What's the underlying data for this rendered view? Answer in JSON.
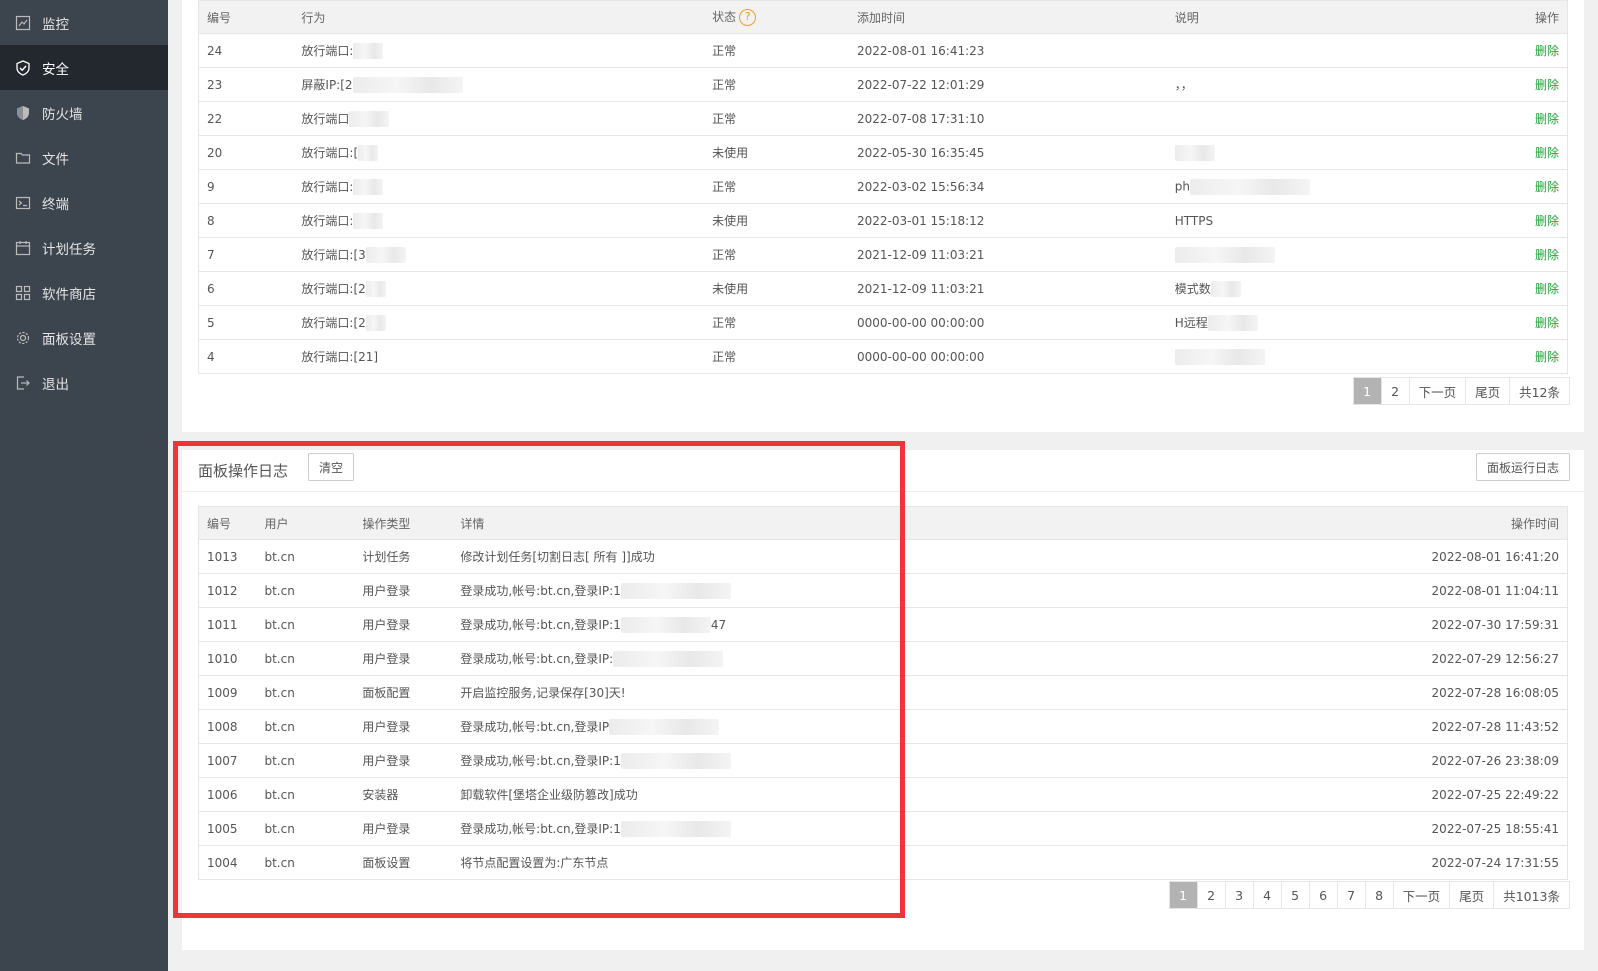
{
  "sidebar": {
    "items": [
      {
        "label": "监控",
        "icon": "monitor-icon",
        "active": false
      },
      {
        "label": "安全",
        "icon": "shield-check-icon",
        "active": true
      },
      {
        "label": "防火墙",
        "icon": "firewall-shield-icon",
        "active": false
      },
      {
        "label": "文件",
        "icon": "folder-icon",
        "active": false
      },
      {
        "label": "终端",
        "icon": "terminal-icon",
        "active": false
      },
      {
        "label": "计划任务",
        "icon": "calendar-icon",
        "active": false
      },
      {
        "label": "软件商店",
        "icon": "grid-icon",
        "active": false
      },
      {
        "label": "面板设置",
        "icon": "gear-icon",
        "active": false
      },
      {
        "label": "退出",
        "icon": "logout-icon",
        "active": false
      }
    ]
  },
  "firewall_table": {
    "columns": {
      "id": "编号",
      "action": "行为",
      "status": "状态",
      "status_help": "?",
      "time": "添加时间",
      "note": "说明",
      "op": "操作"
    },
    "rows": [
      {
        "id": "24",
        "action": "放行端口:",
        "status": "正常",
        "time": "2022-08-01 16:41:23",
        "note": "",
        "op": "删除"
      },
      {
        "id": "23",
        "action": "屏蔽IP:[2",
        "status": "正常",
        "time": "2022-07-22 12:01:29",
        "note": "，，",
        "op": "删除"
      },
      {
        "id": "22",
        "action": "放行端口",
        "status": "正常",
        "time": "2022-07-08 17:31:10",
        "note": "",
        "op": "删除"
      },
      {
        "id": "20",
        "action": "放行端口:[",
        "status": "未使用",
        "time": "2022-05-30 16:35:45",
        "note": "",
        "op": "删除"
      },
      {
        "id": "9",
        "action": "放行端口:",
        "status": "正常",
        "time": "2022-03-02 15:56:34",
        "note": "ph",
        "op": "删除"
      },
      {
        "id": "8",
        "action": "放行端口:",
        "status": "未使用",
        "time": "2022-03-01 15:18:12",
        "note": "HTTPS",
        "op": "删除"
      },
      {
        "id": "7",
        "action": "放行端口:[3",
        "status": "正常",
        "time": "2021-12-09 11:03:21",
        "note": "",
        "op": "删除"
      },
      {
        "id": "6",
        "action": "放行端口:[2",
        "status": "未使用",
        "time": "2021-12-09 11:03:21",
        "note": "模式数",
        "op": "删除"
      },
      {
        "id": "5",
        "action": "放行端口:[2",
        "status": "正常",
        "time": "0000-00-00 00:00:00",
        "note": "H远程",
        "op": "删除"
      },
      {
        "id": "4",
        "action": "放行端口:[21]",
        "status": "正常",
        "time": "0000-00-00 00:00:00",
        "note": "",
        "op": "删除"
      }
    ],
    "pager": {
      "pages": [
        "1",
        "2"
      ],
      "current": "1",
      "next": "下一页",
      "last": "尾页",
      "total": "共12条"
    }
  },
  "log_panel": {
    "title": "面板操作日志",
    "clear_label": "清空",
    "runlog_label": "面板运行日志",
    "columns": {
      "id": "编号",
      "user": "用户",
      "type": "操作类型",
      "detail": "详情",
      "time": "操作时间"
    },
    "rows": [
      {
        "id": "1013",
        "user": "bt.cn",
        "type": "计划任务",
        "detail": "修改计划任务[切割日志[ 所有 ]]成功",
        "time": "2022-08-01 16:41:20"
      },
      {
        "id": "1012",
        "user": "bt.cn",
        "type": "用户登录",
        "detail": "登录成功,帐号:bt.cn,登录IP:1",
        "time": "2022-08-01 11:04:11"
      },
      {
        "id": "1011",
        "user": "bt.cn",
        "type": "用户登录",
        "detail": "登录成功,帐号:bt.cn,登录IP:1",
        "detail_tail": "47",
        "time": "2022-07-30 17:59:31"
      },
      {
        "id": "1010",
        "user": "bt.cn",
        "type": "用户登录",
        "detail": "登录成功,帐号:bt.cn,登录IP:",
        "time": "2022-07-29 12:56:27"
      },
      {
        "id": "1009",
        "user": "bt.cn",
        "type": "面板配置",
        "detail": "开启监控服务,记录保存[30]天!",
        "time": "2022-07-28 16:08:05"
      },
      {
        "id": "1008",
        "user": "bt.cn",
        "type": "用户登录",
        "detail": "登录成功,帐号:bt.cn,登录IP",
        "time": "2022-07-28 11:43:52"
      },
      {
        "id": "1007",
        "user": "bt.cn",
        "type": "用户登录",
        "detail": "登录成功,帐号:bt.cn,登录IP:1",
        "time": "2022-07-26 23:38:09"
      },
      {
        "id": "1006",
        "user": "bt.cn",
        "type": "安装器",
        "detail": "卸载软件[堡塔企业级防篡改]成功",
        "time": "2022-07-25 22:49:22"
      },
      {
        "id": "1005",
        "user": "bt.cn",
        "type": "用户登录",
        "detail": "登录成功,帐号:bt.cn,登录IP:1",
        "time": "2022-07-25 18:55:41"
      },
      {
        "id": "1004",
        "user": "bt.cn",
        "type": "面板设置",
        "detail": "将节点配置设置为:广东节点",
        "time": "2022-07-24 17:31:55"
      }
    ],
    "pager": {
      "pages": [
        "1",
        "2",
        "3",
        "4",
        "5",
        "6",
        "7",
        "8"
      ],
      "current": "1",
      "next": "下一页",
      "last": "尾页",
      "total": "共1013条"
    }
  },
  "colors": {
    "sidebar_bg": "#3c444d",
    "sidebar_active": "#22282e",
    "link_green": "#20a53a",
    "highlight_red": "#f0343c"
  }
}
